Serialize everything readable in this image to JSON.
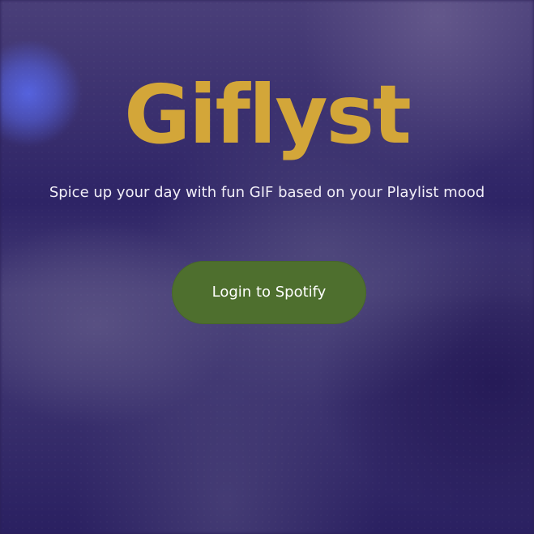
{
  "app": {
    "title": "Giflyst",
    "tagline": "Spice up your day with fun GIF based on your Playlist mood"
  },
  "actions": {
    "login_label": "Login to Spotify"
  },
  "colors": {
    "title": "#d3a639",
    "button": "#4e6f2e",
    "background": "#2a1f55",
    "text": "#f1eef7"
  }
}
